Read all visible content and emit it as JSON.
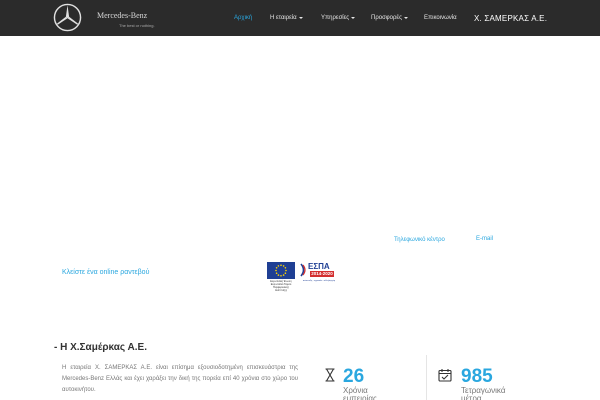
{
  "header": {
    "brand": {
      "name": "Mercedes-Benz",
      "tagline": "The best or nothing."
    },
    "nav": [
      {
        "label": "Αρχική",
        "active": true,
        "dropdown": false
      },
      {
        "label": "Η εταιρεία",
        "active": false,
        "dropdown": true
      },
      {
        "label": "Υπηρεσίες",
        "active": false,
        "dropdown": true
      },
      {
        "label": "Προσφορές",
        "active": false,
        "dropdown": true
      },
      {
        "label": "Επικοινωνία",
        "active": false,
        "dropdown": false
      }
    ],
    "company": "Χ. ΣΑΜΕΡΚΑΣ Α.Ε."
  },
  "contact": {
    "phone_label": "Τηλεφωνικό κέντρο",
    "email_label": "E-mail"
  },
  "appointment": {
    "label": "Κλείστε ένα online ραντεβού"
  },
  "espa": {
    "eu_caption": "Ευρωπαϊκή Ένωση Ευρωπαϊκό Ταμείο Περιφερειακής Ανάπτυξης",
    "title": "ΕΣΠΑ",
    "years": "2014-2020",
    "motto": "ανάπτυξη - εργασία - αλληλεγγύη"
  },
  "about": {
    "title": "- Η Χ.Σαμέρκας Α.Ε.",
    "text": "Η εταιρεία Χ. ΣΑΜΕΡΚΑΣ Α.Ε. είναι επίσημα εξουσιοδοτημένη επισκευάστρια της Mercedes-Benz Ελλάς και έχει χαράξει την δική της πορεία επί 40 χρόνια στο χώρο του αυτοκινήτου."
  },
  "stats": [
    {
      "icon": "hourglass-icon",
      "value": "26",
      "label": "Χρόνια εμπειρίας"
    },
    {
      "icon": "calendar-icon",
      "value": "985",
      "label": "Τετραγωνικά μέτρα"
    }
  ],
  "colors": {
    "navbar": "#2b2b2b",
    "accent": "#2aa7df",
    "company_text": "#ffffff"
  }
}
